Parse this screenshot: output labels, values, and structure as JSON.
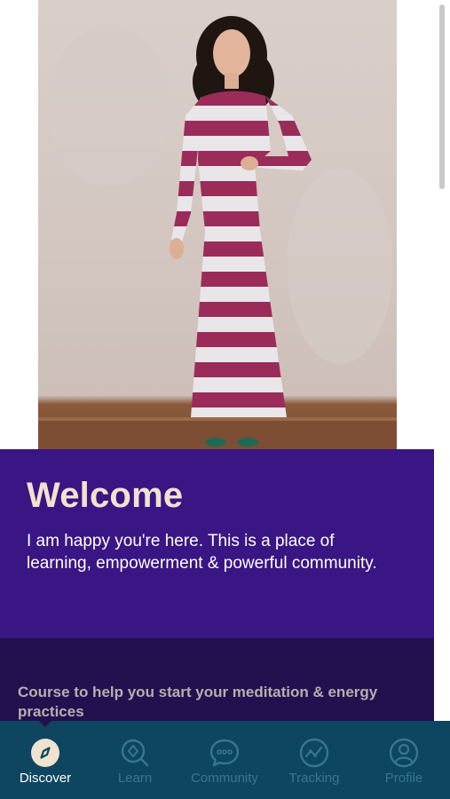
{
  "welcome": {
    "title": "Welcome",
    "text": "I am happy you're here. This is a place of learning, empowerment & powerful community."
  },
  "course": {
    "text": "Course to help you start your meditation & energy practices"
  },
  "nav": {
    "items": [
      {
        "label": "Discover",
        "icon": "compass-icon",
        "active": true
      },
      {
        "label": "Learn",
        "icon": "learn-search-icon",
        "active": false
      },
      {
        "label": "Community",
        "icon": "chat-bubble-icon",
        "active": false
      },
      {
        "label": "Tracking",
        "icon": "tracking-graph-icon",
        "active": false
      },
      {
        "label": "Profile",
        "icon": "profile-icon",
        "active": false
      }
    ]
  },
  "colors": {
    "welcome_bg": "#3a1584",
    "course_bg": "#23104f",
    "nav_bg": "#0e4560",
    "title_color": "#efe3cf",
    "inactive_nav": "#3a7590"
  }
}
